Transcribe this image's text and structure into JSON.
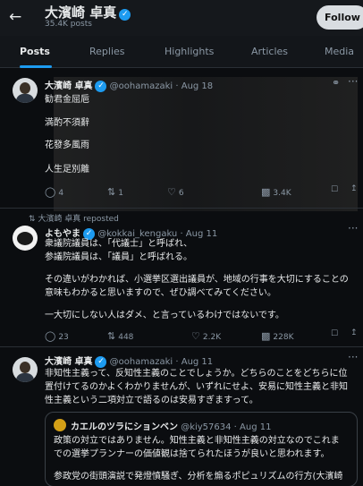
{
  "header": {
    "back_icon": "arrow-left-icon",
    "name": "大濱崎 卓真",
    "post_count": "35.4K posts",
    "follow_label": "Follow"
  },
  "tabs": [
    "Posts",
    "Replies",
    "Highlights",
    "Articles",
    "Media"
  ],
  "colors": {
    "accent": "#1d9bf0",
    "background": "#0b0d10",
    "muted": "#8b98a5"
  },
  "tweets": [
    {
      "name": "大濱崎 卓真",
      "handle": "@oohamazaki · Aug 18",
      "lines": [
        "勧君金屈巵",
        "満酌不須辭",
        "花發多風雨",
        "人生足別離"
      ],
      "replies": "4",
      "reposts": "1",
      "likes": "6",
      "views": "3.4K"
    },
    {
      "repost_label": "大濱崎 卓真 reposted",
      "name": "よもやま",
      "handle": "@kokkai_kengaku · Aug 11",
      "lines": [
        "衆議院議員は、「代議士」と呼ばれ、",
        "参議院議員は、「議員」と呼ばれる。",
        "",
        "その違いがわかれば、小選挙区選出議員が、地域の行事を大切にすることの",
        "意味もわかると思いますので、ぜひ調べてみてください。",
        "",
        "一大切にしない人はダメ、と言っているわけではないです。"
      ],
      "replies": "23",
      "reposts": "448",
      "likes": "2.2K",
      "views": "228K"
    },
    {
      "name": "大濱崎 卓真",
      "handle": "@oohamazaki · Aug 11",
      "lines": [
        "非知性主義って、反知性主義のことでしょうか。どちらのことをどちらに位",
        "置付けてるのかよくわかりませんが、いずれにせよ、安易に知性主義と非知",
        "性主義という二項対立で語るのは安易すぎますって。"
      ],
      "quote": {
        "name": "カエルのツラにションベン",
        "handle": "@kiy57634 · Aug 11",
        "lines": [
          "政策の対立ではありません。知性主義と非知性主義の対立なのでこれま",
          "での選挙プランナーの価値観は捨てられたほうが良いと思われます。",
          "",
          "参政党の街頭演説で発燈憤騒ぎ、分析を煽るポピュリズムの行方(大濱崎"
        ]
      }
    }
  ]
}
